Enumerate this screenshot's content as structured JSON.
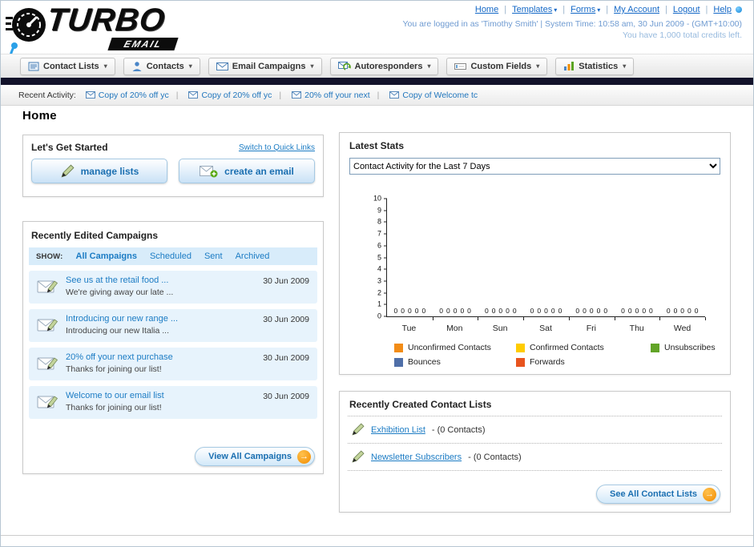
{
  "colors": {
    "link_blue": "#1c7cc4",
    "dark_bar": "#12122a",
    "row_light_blue": "#e7f3fc",
    "button_text_blue": "#1b6fb1",
    "orange_accent": "#f28c00"
  },
  "header": {
    "logo": {
      "title": "TURBO",
      "subtitle": "EMAIL"
    },
    "links": [
      {
        "label": "Home"
      },
      {
        "label": "Templates",
        "dropdown": true
      },
      {
        "label": "Forms",
        "dropdown": true
      },
      {
        "label": "My Account"
      },
      {
        "label": "Logout"
      },
      {
        "label": "Help"
      }
    ],
    "login_info": "You are logged in as 'Timothy Smith' | System Time: 10:58 am, 30 Jun 2009 - (GMT+10:00)",
    "credits_info": "You have 1,000 total credits left."
  },
  "nav_tabs": [
    {
      "label": "Contact Lists",
      "icon": "contact-lists-icon"
    },
    {
      "label": "Contacts",
      "icon": "contacts-icon"
    },
    {
      "label": "Email Campaigns",
      "icon": "email-campaigns-icon"
    },
    {
      "label": "Autoresponders",
      "icon": "autoresponders-icon"
    },
    {
      "label": "Custom Fields",
      "icon": "custom-fields-icon"
    },
    {
      "label": "Statistics",
      "icon": "statistics-icon"
    }
  ],
  "recent_activity": {
    "label": "Recent Activity:",
    "items": [
      {
        "label": "Copy of 20% off yc"
      },
      {
        "label": "Copy of 20% off yc"
      },
      {
        "label": "20% off your next"
      },
      {
        "label": "Copy of Welcome tc"
      }
    ]
  },
  "page": {
    "title": "Home"
  },
  "get_started": {
    "title": "Let's Get Started",
    "switch_link": "Switch to Quick Links",
    "manage_lists_label": "manage lists",
    "create_email_label": "create an email"
  },
  "campaigns": {
    "title": "Recently Edited Campaigns",
    "show_label": "SHOW:",
    "filters": [
      {
        "label": "All Campaigns",
        "active": true
      },
      {
        "label": "Scheduled"
      },
      {
        "label": "Sent"
      },
      {
        "label": "Archived"
      }
    ],
    "items": [
      {
        "title": "See us at the retail food ...",
        "subtitle": "We're giving away our late ...",
        "date": "30 Jun 2009"
      },
      {
        "title": "Introducing our new range ...",
        "subtitle": "Introducing our new Italia ...",
        "date": "30 Jun 2009"
      },
      {
        "title": "20% off your next purchase",
        "subtitle": "Thanks for joining our list!",
        "date": "30 Jun 2009"
      },
      {
        "title": "Welcome to our email list",
        "subtitle": "Thanks for joining our list!",
        "date": "30 Jun 2009"
      }
    ],
    "view_all_label": "View All Campaigns"
  },
  "stats": {
    "title": "Latest Stats",
    "dropdown_value": "Contact Activity for the Last 7 Days",
    "chart_data": {
      "type": "bar",
      "title": "Contact Activity for the Last 7 Days",
      "categories": [
        "Tue",
        "Mon",
        "Sun",
        "Sat",
        "Fri",
        "Thu",
        "Wed"
      ],
      "series": [
        {
          "name": "Unconfirmed Contacts",
          "color": "#f28c17",
          "values": [
            0,
            0,
            0,
            0,
            0,
            0,
            0
          ]
        },
        {
          "name": "Confirmed Contacts",
          "color": "#ffcc00",
          "values": [
            0,
            0,
            0,
            0,
            0,
            0,
            0
          ]
        },
        {
          "name": "Unsubscribes",
          "color": "#62a427",
          "values": [
            0,
            0,
            0,
            0,
            0,
            0,
            0
          ]
        },
        {
          "name": "Bounces",
          "color": "#4f6fa8",
          "values": [
            0,
            0,
            0,
            0,
            0,
            0,
            0
          ]
        },
        {
          "name": "Forwards",
          "color": "#e8541e",
          "values": [
            0,
            0,
            0,
            0,
            0,
            0,
            0
          ]
        }
      ],
      "ylim": [
        0,
        10
      ],
      "y_tick_step": 1,
      "grid": false,
      "legend_position": "bottom",
      "value_labels_shown": true
    }
  },
  "contact_lists": {
    "title": "Recently Created Contact Lists",
    "items": [
      {
        "name": "Exhibition List",
        "detail": "- (0 Contacts)"
      },
      {
        "name": "Newsletter Subscribers",
        "detail": "- (0 Contacts)"
      }
    ],
    "see_all_label": "See All Contact Lists"
  }
}
